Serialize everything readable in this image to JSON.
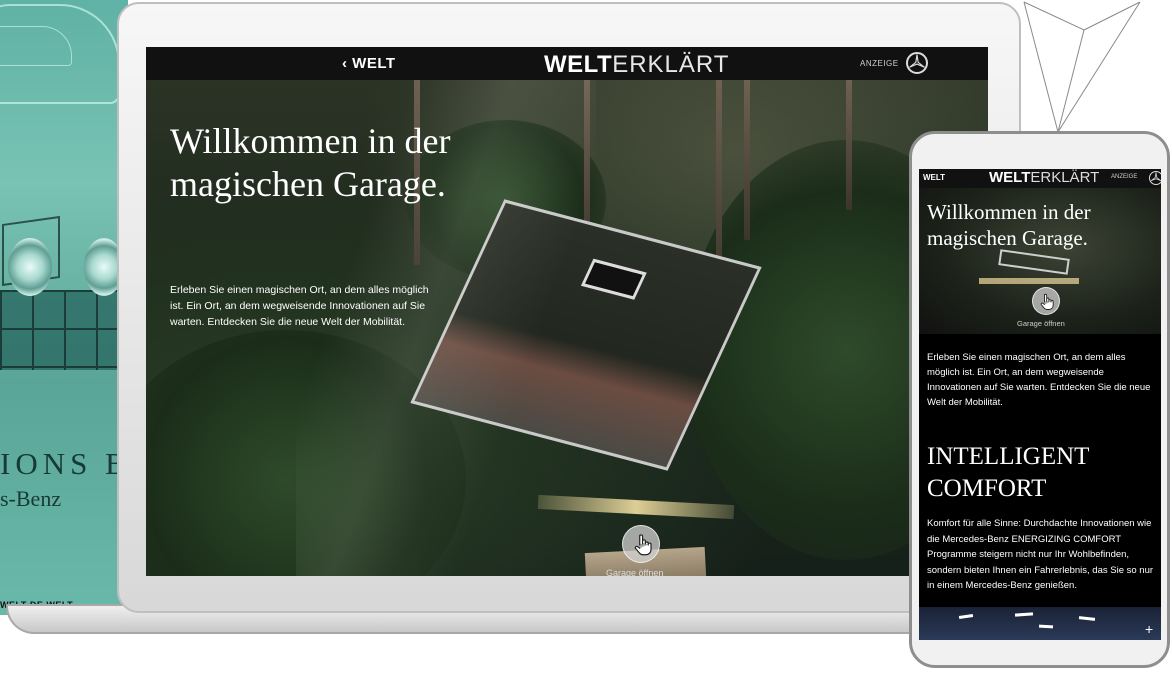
{
  "background_print": {
    "headline": "IONS B",
    "subline": "s-Benz",
    "strip_text": "WELT DE WELT"
  },
  "laptop": {
    "topbar": {
      "back_label": "‹ WELT",
      "logo_bold": "WELT",
      "logo_thin": "ERKLÄRT",
      "ad_label": "ANZEIGE",
      "brand_icon": "mercedes-star-icon"
    },
    "hero": {
      "title": "Willkommen in der magischen Garage.",
      "body": "Erleben Sie einen magischen Ort, an dem alles möglich ist. Ein Ort, an dem wegweisende Innovationen auf Sie warten. Entdecken Sie die neue Welt der Mobilität.",
      "open_button_icon": "hand-pointer-icon",
      "open_caption": "Garage öffnen"
    }
  },
  "phone": {
    "topbar": {
      "back_label": "WELT",
      "logo_bold": "WELT",
      "logo_thin": "ERKLÄRT",
      "ad_label": "ANZEIGE",
      "brand_icon": "mercedes-star-icon"
    },
    "hero": {
      "title": "Willkommen in der magischen Garage.",
      "open_caption": "Garage öffnen"
    },
    "intro_text": "Erleben Sie einen magischen Ort, an dem alles möglich ist. Ein Ort, an dem wegweisende Innovationen auf Sie warten. Entdecken Sie die neue Welt der Mobilität.",
    "section": {
      "heading": "INTELLIGENT COMFORT",
      "body": "Komfort für alle Sinne: Durchdachte Innovationen wie die Mercedes-Benz ENERGIZING COMFORT Programme steigern nicht nur Ihr Wohlbefinden, sondern bieten Ihnen ein Fahrerlebnis, das Sie so nur in einem Mercedes-Benz genießen."
    },
    "expand_label": "+"
  },
  "colors": {
    "topbar": "#111111",
    "text": "#ffffff",
    "device_frame": "#bfbfbf",
    "background_teal": "#6bbbab"
  }
}
